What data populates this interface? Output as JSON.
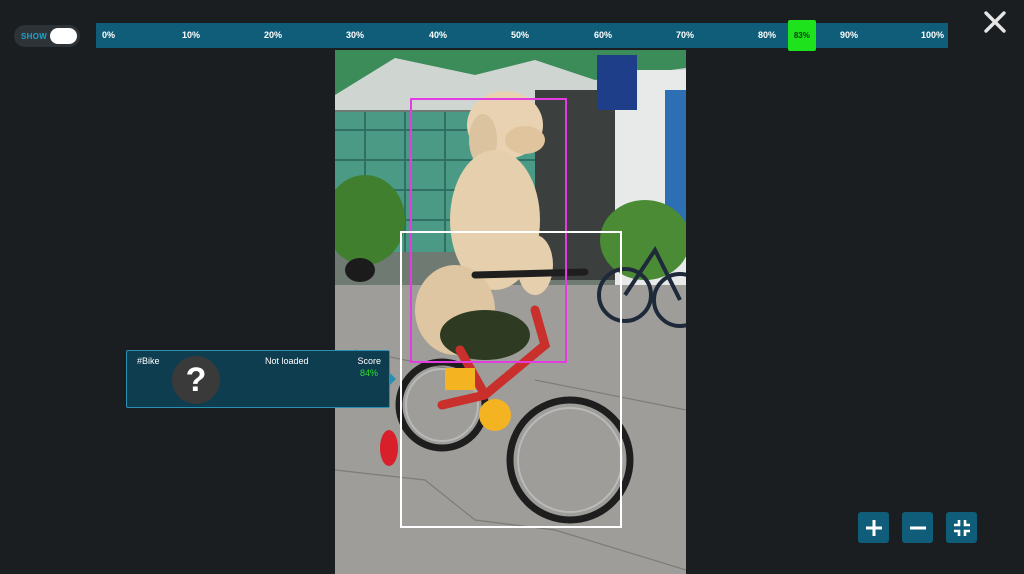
{
  "toggle": {
    "label": "SHOW",
    "on": true
  },
  "threshold": {
    "ticks": [
      "0%",
      "10%",
      "20%",
      "30%",
      "40%",
      "50%",
      "60%",
      "70%",
      "80%",
      "90%",
      "100%"
    ],
    "value_label": "83%",
    "value": 0.83,
    "thumb_color": "#1ee21b",
    "bar_color": "#0f5d78"
  },
  "controls": {
    "close_icon": "close-icon",
    "zoom_in_icon": "plus-icon",
    "zoom_out_icon": "minus-icon",
    "fit_icon": "collapse-icon"
  },
  "detections": [
    {
      "label": "dog",
      "color": "#e23ce2"
    },
    {
      "label": "bike",
      "color": "#ffffff"
    }
  ],
  "info_card": {
    "tag": "#Bike",
    "status": "Not loaded",
    "score_label": "Score",
    "score_value": "84%",
    "avatar_glyph": "?"
  }
}
